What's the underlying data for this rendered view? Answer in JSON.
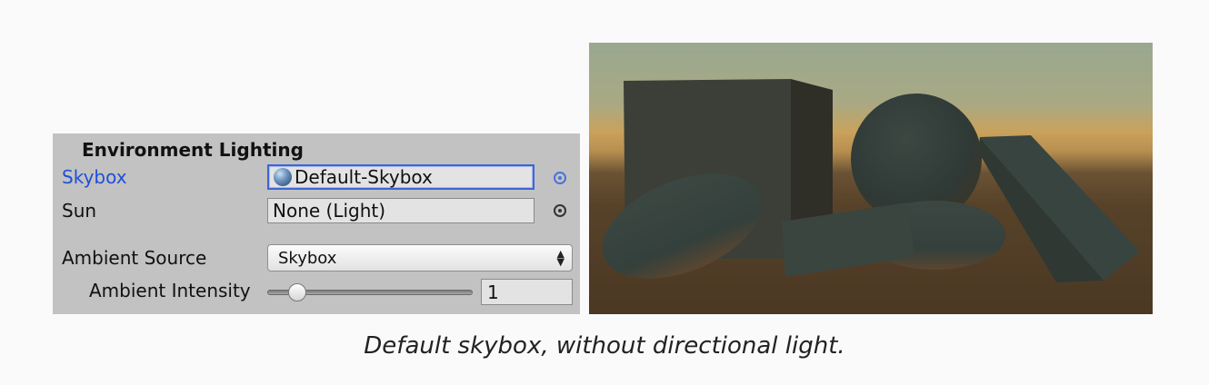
{
  "panel": {
    "title": "Environment Lighting",
    "skybox": {
      "label": "Skybox",
      "value": "Default-Skybox",
      "icon": "sphere-material-icon"
    },
    "sun": {
      "label": "Sun",
      "value": "None (Light)"
    },
    "ambient_source": {
      "label": "Ambient Source",
      "value": "Skybox"
    },
    "ambient_intensity": {
      "label": "Ambient Intensity",
      "value": "1",
      "slider_fraction": 0.14
    },
    "picker_icon": "object-picker-icon"
  },
  "scene": {
    "sky_colors": [
      "#9aa890",
      "#c9a25c",
      "#4f3b26"
    ],
    "objects": [
      "cube",
      "sphere",
      "flat-ellipsoid",
      "box",
      "long-box"
    ]
  },
  "caption": "Default skybox, without directional light."
}
